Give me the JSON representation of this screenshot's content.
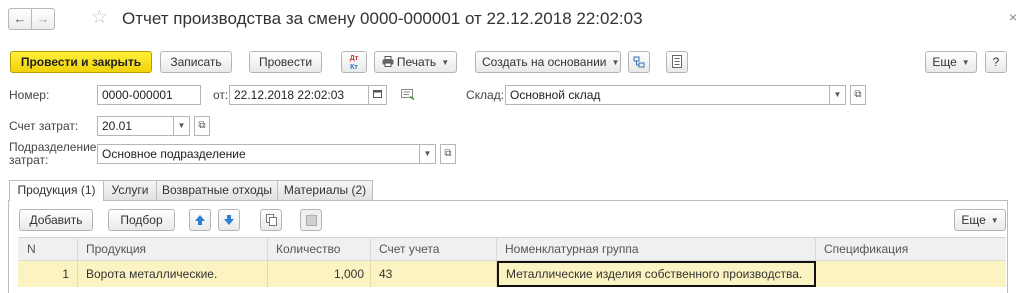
{
  "window": {
    "title": "Отчет производства за смену 0000-000001 от 22.12.2018 22:02:03",
    "back_icon": "←",
    "forward_icon": "→",
    "favorite_icon": "☆",
    "close_icon": "×"
  },
  "toolbar": {
    "post_close": "Провести и закрыть",
    "save": "Записать",
    "post": "Провести",
    "dt_kt_top": "Дт",
    "dt_kt_bottom": "Кт",
    "print": "Печать",
    "create_based": "Создать на основании",
    "more": "Еще",
    "help": "?"
  },
  "form": {
    "number_label": "Номер:",
    "number_value": "0000-000001",
    "date_label": "от:",
    "date_value": "22.12.2018 22:02:03",
    "warehouse_label": "Склад:",
    "warehouse_value": "Основной склад",
    "cost_account_label": "Счет затрат:",
    "cost_account_value": "20.01",
    "division_label_1": "Подразделение",
    "division_label_2": "затрат:",
    "division_value": "Основное подразделение"
  },
  "tabs": [
    {
      "label": "Продукция (1)",
      "active": true
    },
    {
      "label": "Услуги",
      "active": false
    },
    {
      "label": "Возвратные отходы",
      "active": false
    },
    {
      "label": "Материалы (2)",
      "active": false
    }
  ],
  "table_toolbar": {
    "add": "Добавить",
    "pick": "Подбор",
    "more": "Еще"
  },
  "table": {
    "columns": [
      "N",
      "Продукция",
      "Количество",
      "Счет учета",
      "Номенклатурная группа",
      "Спецификация"
    ],
    "rows": [
      {
        "n": "1",
        "product": "Ворота металлические.",
        "quantity": "1,000",
        "account": "43",
        "nomenclature_group": "Металлические изделия собственного производства.",
        "specification": ""
      }
    ]
  },
  "colors": {
    "primary_button": "#f1d20a",
    "selected_row": "#fbf3c2",
    "arrow_blue": "#2f80d6"
  }
}
